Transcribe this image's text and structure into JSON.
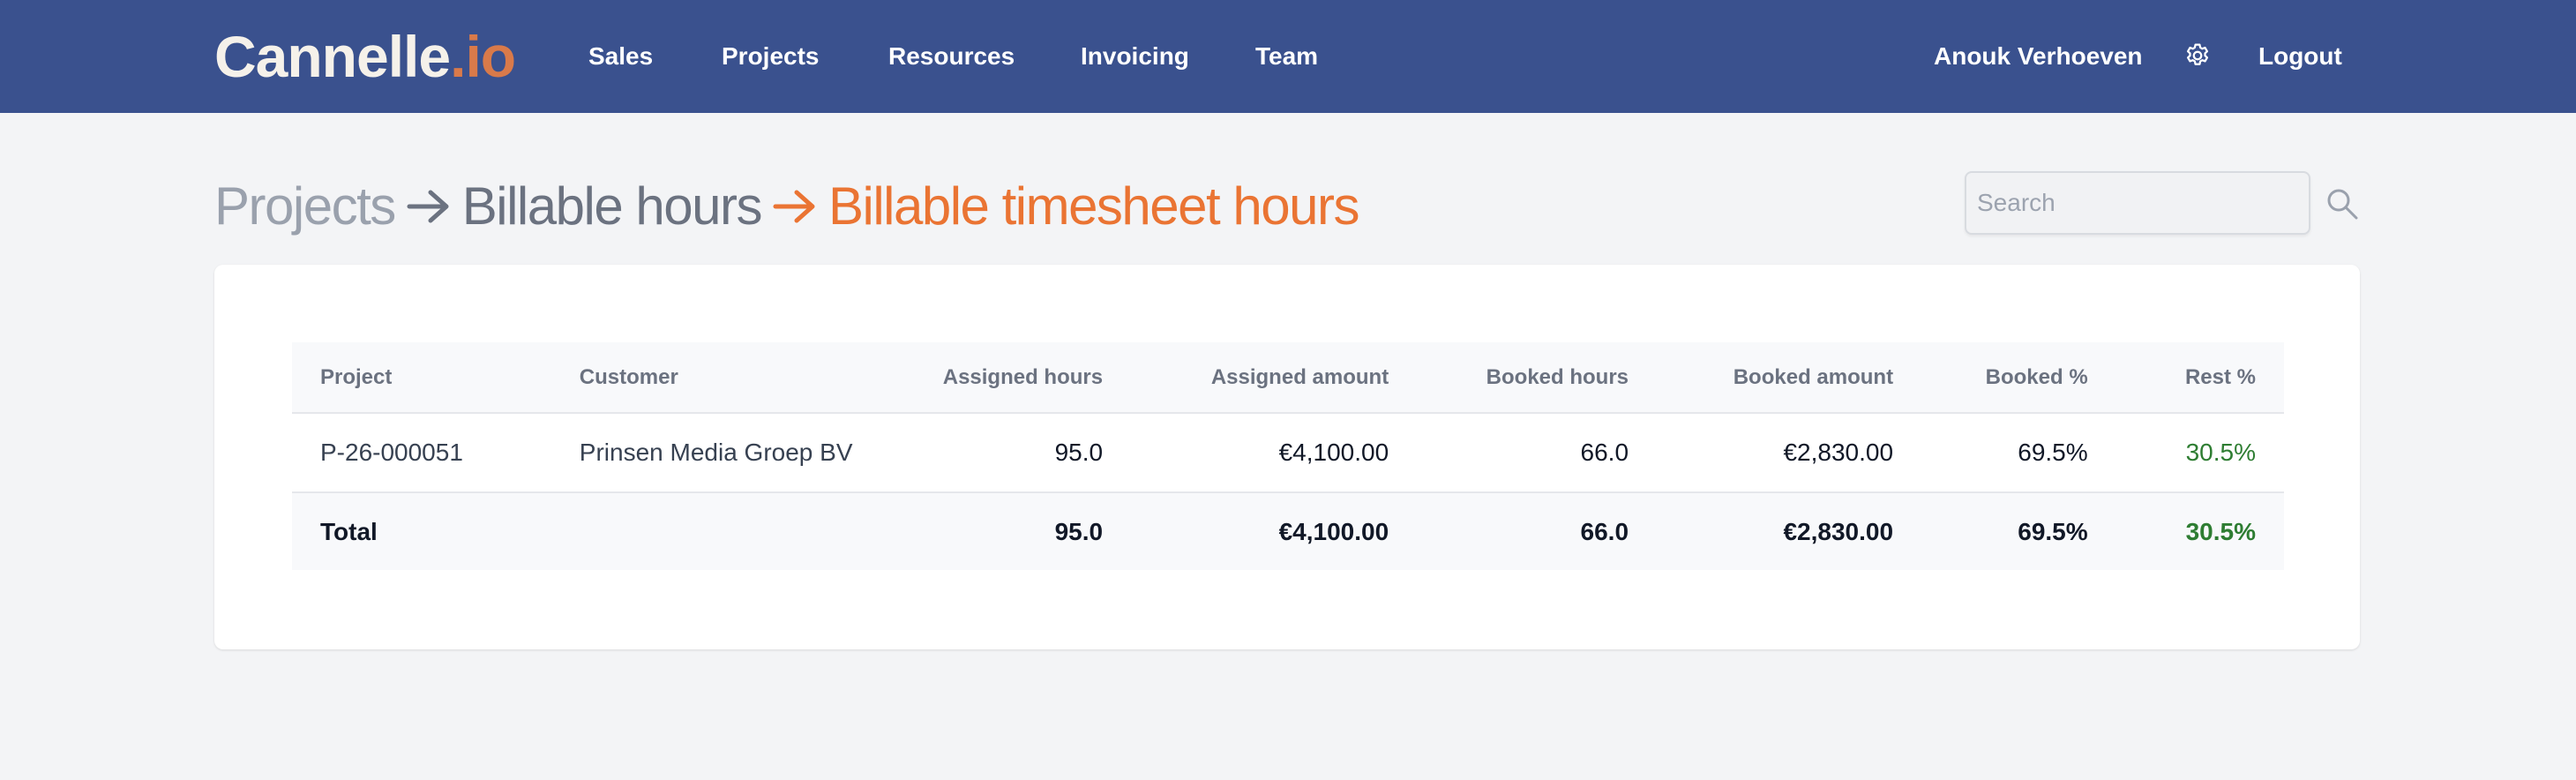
{
  "header": {
    "logo": {
      "name": "Cannelle",
      "dot": ".",
      "tld": "io"
    },
    "nav": [
      "Sales",
      "Projects",
      "Resources",
      "Invoicing",
      "Team"
    ],
    "user_name": "Anouk Verhoeven",
    "settings_icon": "gear-icon",
    "logout_label": "Logout"
  },
  "breadcrumb": {
    "items": [
      "Projects",
      "Billable hours",
      "Billable timesheet hours"
    ],
    "separator_icon": "arrow-right-icon"
  },
  "search": {
    "placeholder": "Search",
    "value": "",
    "icon": "search-icon"
  },
  "table": {
    "columns": [
      "Project",
      "Customer",
      "Assigned hours",
      "Assigned amount",
      "Booked hours",
      "Booked amount",
      "Booked %",
      "Rest %"
    ],
    "rows": [
      [
        "P-26-000051",
        "Prinsen Media Groep BV",
        "95.0",
        "€4,100.00",
        "66.0",
        "€2,830.00",
        "69.5%",
        "30.5%"
      ]
    ],
    "total": [
      "Total",
      "",
      "95.0",
      "€4,100.00",
      "66.0",
      "€2,830.00",
      "69.5%",
      "30.5%"
    ]
  },
  "colors": {
    "header_bg": "#3a518e",
    "accent_orange": "#ea7433",
    "logo_accent": "#d97a4a",
    "rest_green": "#2e7d32",
    "page_bg": "#f3f4f6"
  }
}
